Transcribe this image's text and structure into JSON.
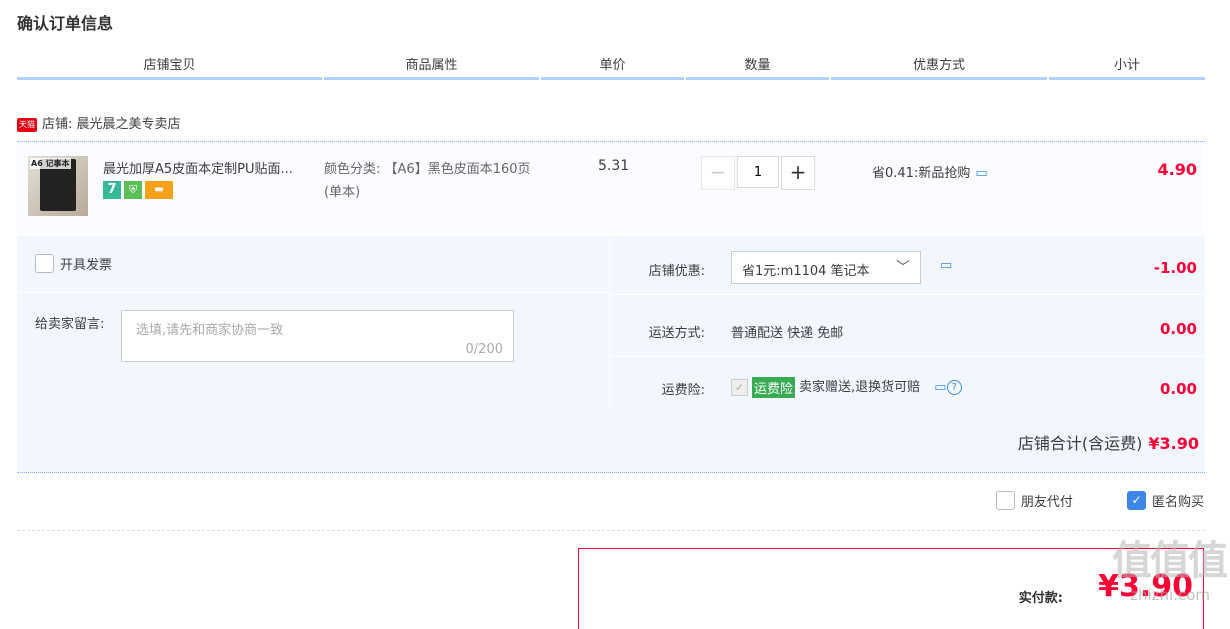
{
  "page_title": "确认订单信息",
  "columns": [
    "店铺宝贝",
    "商品属性",
    "单价",
    "数量",
    "优惠方式",
    "小计"
  ],
  "store": {
    "badge": "天猫",
    "label": "店铺:",
    "name": "晨光晨之美专卖店"
  },
  "item": {
    "thumb_text": "A6\n记事本",
    "name": "晨光加厚A5皮面本定制PU贴面...",
    "badges": [
      "7",
      "shield",
      "card"
    ],
    "attr_label": "颜色分类:",
    "attr_value": "【A6】黑色皮面本160页(单本)",
    "price": "5.31",
    "quantity": "1",
    "minus": "−",
    "plus": "+",
    "promo": "省0.41:新品抢购",
    "subtotal": "4.90"
  },
  "invoice": {
    "label": "开具发票",
    "checked": false
  },
  "note": {
    "label": "给卖家留言:",
    "placeholder": "选填,请先和商家协商一致",
    "count": "0/200"
  },
  "store_discount": {
    "label": "店铺优惠:",
    "selected": "省1元:m1104 笔记本",
    "amount": "-1.00"
  },
  "shipping": {
    "label": "运送方式:",
    "value": "普通配送 快递 免邮",
    "amount": "0.00"
  },
  "insurance": {
    "label": "运费险:",
    "tag": "运费险",
    "text": "卖家赠送,退换货可赔",
    "amount": "0.00"
  },
  "store_total": {
    "label": "店铺合计(含运费)",
    "amount": "¥3.90"
  },
  "options": {
    "friend_pay": "朋友代付",
    "anonymous": "匿名购买",
    "anonymous_checked": true
  },
  "payment": {
    "label": "实付款:",
    "amount": "¥3.90"
  },
  "watermark": {
    "big": "值值值",
    "small": "zhizhi.com"
  },
  "colors": {
    "accent": "#ff0036",
    "header_line": "#b2d1ff",
    "panel_bg": "#f2f7ff",
    "check_blue": "#3c86e8",
    "insurance_green": "#3aab55"
  },
  "icons": {
    "message": "chat-bubble-icon",
    "help": "question-circle-icon",
    "dropdown": "chevron-down-icon"
  }
}
